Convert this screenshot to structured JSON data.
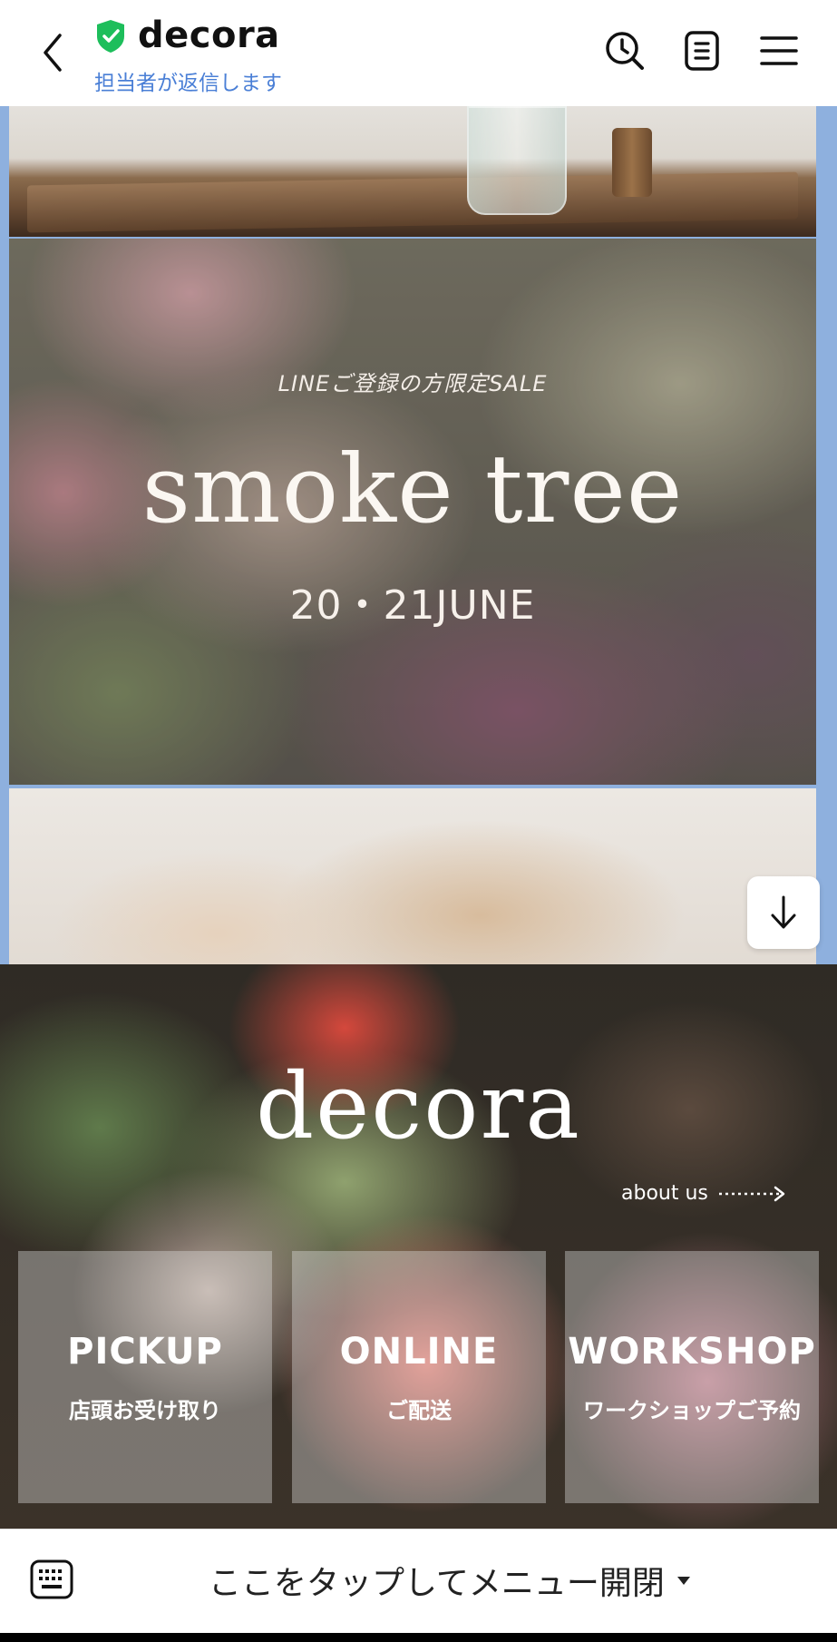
{
  "header": {
    "account_name": "decora",
    "status": "担当者が返信します",
    "icons": [
      "back-icon",
      "verified-shield-icon",
      "history-search-icon",
      "note-icon",
      "menu-icon"
    ]
  },
  "banner": {
    "subtitle": "LINEご登録の方限定SALE",
    "title": "smoke tree",
    "date": "20・21JUNE"
  },
  "rich_menu": {
    "logo": "decora",
    "about_label": "about us",
    "tiles": [
      {
        "title": "PICKUP",
        "subtitle": "店頭お受け取り"
      },
      {
        "title": "ONLINE",
        "subtitle": "ご配送"
      },
      {
        "title": "WORKSHOP",
        "subtitle": "ワークショップご予約"
      }
    ]
  },
  "bottom_bar": {
    "toggle_label": "ここをタップしてメニュー開閉"
  },
  "colors": {
    "status_text": "#4a7fd6",
    "shield": "#1dbe5b",
    "chat_background": "#8eb0de"
  }
}
